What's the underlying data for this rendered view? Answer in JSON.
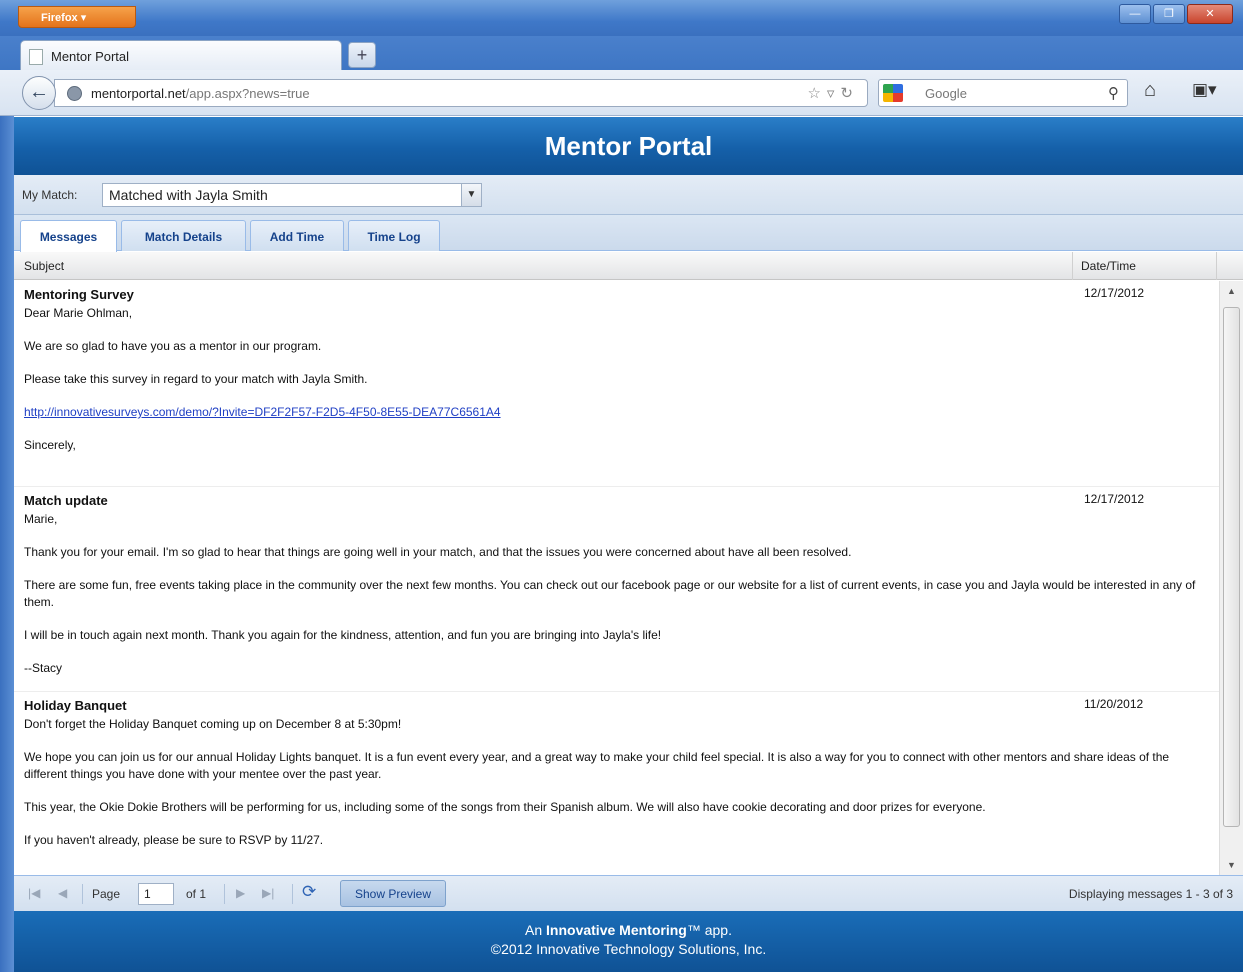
{
  "browser": {
    "app_button": "Firefox",
    "tab_title": "Mentor Portal",
    "new_tab": "+",
    "url_domain": "mentorportal.net",
    "url_path": "/app.aspx?news=true",
    "search_placeholder": "Google",
    "window_controls": [
      "—",
      "❐",
      "✕"
    ]
  },
  "app": {
    "title": "Mentor Portal",
    "match_label": "My Match:",
    "match_value": "Matched with Jayla Smith",
    "tabs": [
      "Messages",
      "Match Details",
      "Add Time",
      "Time Log"
    ],
    "columns": {
      "subject": "Subject",
      "date": "Date/Time"
    },
    "messages": [
      {
        "subject": "Mentoring Survey",
        "date": "12/17/2012",
        "lines": [
          "Dear Marie Ohlman,",
          "We are so glad to have you as a mentor in our program.",
          "Please take this survey in regard to your match with Jayla Smith.",
          "http://innovativesurveys.com/demo/?Invite=DF2F2F57-F2D5-4F50-8E55-DEA77C6561A4",
          "Sincerely,"
        ]
      },
      {
        "subject": "Match update",
        "date": "12/17/2012",
        "lines": [
          "Marie,",
          "Thank you for your email.  I'm so glad to hear that things are going well in your match, and that the issues you were concerned about have all been resolved.",
          "There are some fun, free events taking place in the community over the next few months.  You can check out our facebook page or our website for a list of current events, in case you and Jayla would be interested in any of them.",
          "I will be in touch again next month.  Thank you again for the kindness, attention, and fun you are bringing into Jayla's life!",
          "--Stacy"
        ]
      },
      {
        "subject": "Holiday Banquet",
        "date": "11/20/2012",
        "lines": [
          "Don't forget the Holiday Banquet coming up on December 8 at 5:30pm!",
          "We hope you can join us for our annual Holiday Lights banquet. It is a fun event every year, and a great way to make your child feel special. It is also a way for you to connect with other mentors and share ideas of the different things you have done with your mentee over the past year.",
          "This year, the Okie Dokie Brothers will be performing for us, including some of the songs from their Spanish album. We will also have cookie decorating and door prizes for everyone.",
          "If you haven't already, please be sure to RSVP by 11/27."
        ]
      }
    ],
    "pager": {
      "page_label": "Page",
      "page_value": "1",
      "of_label": "of 1",
      "show_preview": "Show Preview",
      "display_text": "Displaying messages 1 - 3 of 3"
    },
    "footer": {
      "line1_prefix": "An ",
      "brand": "Innovative Mentoring",
      "line1_suffix": "™ app.",
      "line2": "©2012 Innovative Technology Solutions, Inc."
    }
  }
}
